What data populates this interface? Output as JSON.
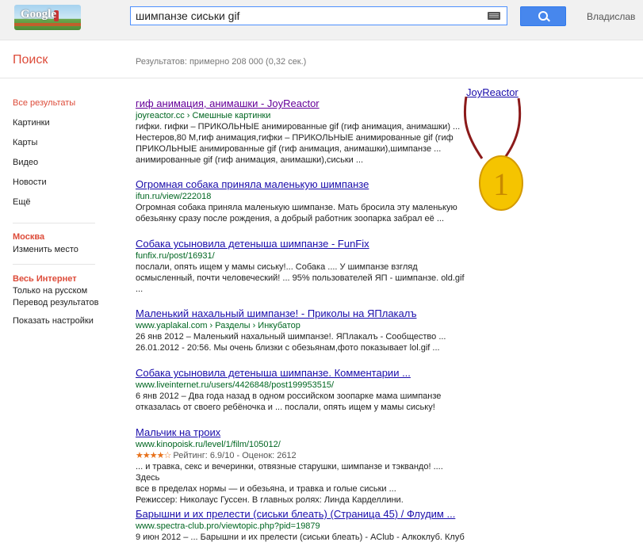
{
  "header": {
    "logo_text": "Google",
    "query": "шимпанзе сиськи gif",
    "search_icon": "search-icon",
    "keyboard_icon": "keyboard-icon",
    "user_name": "Владислав"
  },
  "search_label": "Поиск",
  "result_stats": "Результатов: примерно 208 000 (0,32 сек.)",
  "sidebar": {
    "items": [
      {
        "label": "Все результаты",
        "active": true
      },
      {
        "label": "Картинки"
      },
      {
        "label": "Карты"
      },
      {
        "label": "Видео"
      },
      {
        "label": "Новости"
      },
      {
        "label": "Ещё"
      }
    ],
    "location_title": "Москва",
    "location_change": "Изменить место",
    "web_title": "Весь Интернет",
    "russian_only": "Только на русском",
    "translated": "Перевод результатов",
    "show_tools": "Показать настройки"
  },
  "overlay": {
    "joy_link": "JoyReactor",
    "medal_number": "1",
    "medal_color": "#f5c400",
    "ribbon_color": "#8b1a1a"
  },
  "results": [
    {
      "title": "гиф анимация, анимашки - JoyReactor",
      "url": "joyreactor.cc › Смешные картинки",
      "snippet_lines": [
        "гифки. гифки – ПРИКОЛЬНЫЕ анимированные gif (гиф анимация, анимашки) ...",
        "Нестеров,80 M,гиф анимация,гифки – ПРИКОЛЬНЫЕ анимированные gif (гиф",
        "ПРИКОЛЬНЫЕ анимированные gif (гиф анимация, анимашки),шимпанзе ...",
        "анимированные gif (гиф анимация, анимашки),сиськи ..."
      ]
    },
    {
      "title": "Огромная собака приняла маленькую шимпанзе",
      "url": "ifun.ru/view/222018",
      "snippet_lines": [
        "Огромная собака приняла маленькую шимпанзе. Мать бросила эту маленькую",
        "обезьянку сразу после рождения, а добрый работник зоопарка забрал её ..."
      ]
    },
    {
      "title": "Собака усыновила детеныша шимпанзе - FunFix",
      "url": "funfix.ru/post/16931/",
      "snippet_lines": [
        "послали, опять ищем у мамы сиську!... Собака .... У шимпанзе взгляд",
        "осмысленный, почти человеческий! ... 95% пользователей ЯП - шимпанзе. old.gif",
        "..."
      ]
    },
    {
      "title": "Маленький нахальный шимпанзе! - Приколы на ЯПлакалъ",
      "url": "www.yaplakal.com › Разделы › Инкубатор",
      "snippet_lines": [
        "26 янв 2012 – Маленький нахальный шимпанзе!. ЯПлакалъ - Сообщество ...",
        "26.01.2012 - 20:56. Мы очень близки с обезьянам,фото показывает lol.gif ..."
      ]
    },
    {
      "title": "Собака усыновила детеныша шимпанзе. Комментарии ...",
      "url": "www.liveinternet.ru/users/4426848/post199953515/",
      "snippet_lines": [
        "6 янв 2012 – Два года назад в одном российском зоопарке мама шимпанзе",
        "отказалась от своего ребёночка и ... послали, опять ищем у мамы сиську!"
      ]
    },
    {
      "title": "Мальчик на троих",
      "url": "www.kinopoisk.ru/level/1/film/105012/",
      "stars": "★★★★☆",
      "rating": "Рейтинг: 6.9/10 - Оценок: 2612",
      "snippet_lines": [
        "... и травка, секс и вечеринки, отвязные старушки, шимпанзе и тэквандо! .... Здесь",
        "все в пределах нормы — и обезьяна, и травка и голые сиськи ...",
        "Режиссер: Николаус Гуссен. В главных ролях: Линда Карделлини."
      ]
    },
    {
      "title": "Барышни и их прелести (сиськи блеать) (Страница 45) / Флудим ...",
      "url": "www.spectra-club.pro/viewtopic.php?pid=19879",
      "snippet_lines": [
        "9 июн 2012 – ... Барышни и их прелести (сиськи блеать) - AClub - Алкоклуб. Клуб"
      ]
    }
  ]
}
